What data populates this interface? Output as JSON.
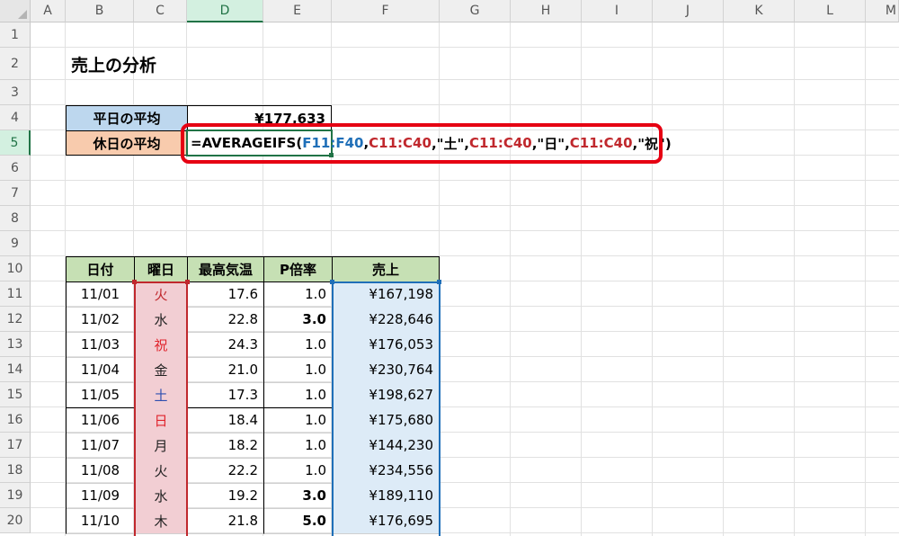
{
  "columns": [
    "A",
    "B",
    "C",
    "D",
    "E",
    "F",
    "G",
    "H",
    "I",
    "J",
    "K",
    "L",
    "M"
  ],
  "rows": [
    "1",
    "2",
    "3",
    "4",
    "5",
    "6",
    "7",
    "8",
    "9",
    "10",
    "11",
    "12",
    "13",
    "14",
    "15",
    "16",
    "17",
    "18",
    "19",
    "20"
  ],
  "title": "売上の分析",
  "summary": {
    "weekday_label": "平日の平均",
    "weekday_value": "¥177,633",
    "holiday_label": "休日の平均"
  },
  "formula": {
    "prefix": "=AVERAGEIFS(",
    "arg1": "F11:F40",
    "comma1": ",",
    "arg2": "C11:C40",
    "text2": ",\"土\",",
    "arg3": "C11:C40",
    "text3": ",\"日\",",
    "arg4": "C11:C40",
    "text4": ",\"祝\")"
  },
  "table": {
    "headers": [
      "日付",
      "曜日",
      "最高気温",
      "P倍率",
      "売上"
    ],
    "rows": [
      {
        "date": "11/01",
        "day": "火",
        "temp": "17.6",
        "p": "1.0",
        "sales": "¥167,198",
        "day_color": "#c0282d",
        "p_bold": false
      },
      {
        "date": "11/02",
        "day": "水",
        "temp": "22.8",
        "p": "3.0",
        "sales": "¥228,646",
        "day_color": "#222222",
        "p_bold": true
      },
      {
        "date": "11/03",
        "day": "祝",
        "temp": "24.3",
        "p": "1.0",
        "sales": "¥176,053",
        "day_color": "#e0242c",
        "p_bold": false
      },
      {
        "date": "11/04",
        "day": "金",
        "temp": "21.0",
        "p": "1.0",
        "sales": "¥230,764",
        "day_color": "#222222",
        "p_bold": false
      },
      {
        "date": "11/05",
        "day": "土",
        "temp": "17.3",
        "p": "1.0",
        "sales": "¥198,627",
        "day_color": "#2f4fb0",
        "p_bold": false
      },
      {
        "date": "11/06",
        "day": "日",
        "temp": "18.4",
        "p": "1.0",
        "sales": "¥175,680",
        "day_color": "#e0242c",
        "p_bold": false
      },
      {
        "date": "11/07",
        "day": "月",
        "temp": "18.2",
        "p": "1.0",
        "sales": "¥144,230",
        "day_color": "#222222",
        "p_bold": false
      },
      {
        "date": "11/08",
        "day": "火",
        "temp": "22.2",
        "p": "1.0",
        "sales": "¥234,556",
        "day_color": "#222222",
        "p_bold": false
      },
      {
        "date": "11/09",
        "day": "水",
        "temp": "19.2",
        "p": "3.0",
        "sales": "¥189,110",
        "day_color": "#222222",
        "p_bold": true
      },
      {
        "date": "11/10",
        "day": "木",
        "temp": "21.8",
        "p": "5.0",
        "sales": "¥176,695",
        "day_color": "#222222",
        "p_bold": true
      }
    ]
  },
  "colors": {
    "label_blue": "#bdd7ee",
    "label_orange": "#f8cbad",
    "header_green": "#c6e0b4",
    "day_pink": "#f2ced3",
    "sales_blue": "#ddebf7",
    "highlight_red": "#e60012",
    "excel_green": "#217346"
  }
}
